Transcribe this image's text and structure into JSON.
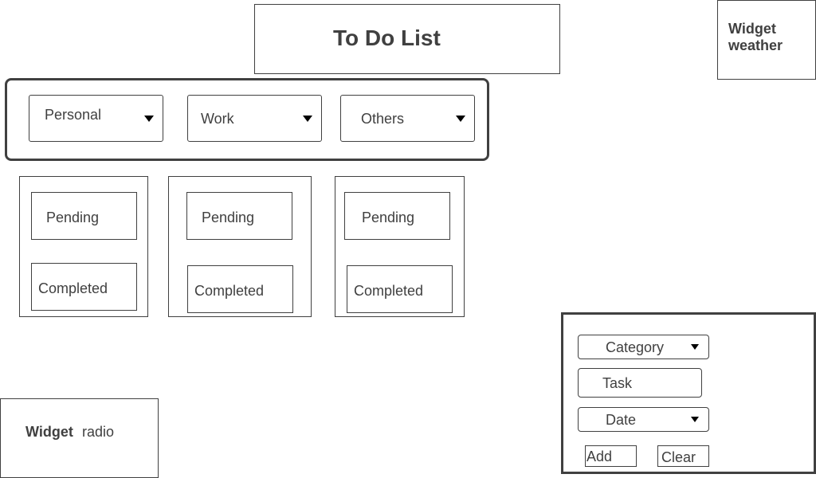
{
  "header": {
    "title": "To Do List"
  },
  "widgets": {
    "weather": {
      "bold_label": "Widget",
      "label": "weather"
    },
    "radio": {
      "bold_label": "Widget",
      "label": "radio"
    }
  },
  "category_tabs": [
    {
      "label": "Personal"
    },
    {
      "label": "Work"
    },
    {
      "label": "Others"
    }
  ],
  "columns": [
    {
      "pending_label": "Pending",
      "completed_label": "Completed"
    },
    {
      "pending_label": "Pending",
      "completed_label": "Completed"
    },
    {
      "pending_label": "Pending",
      "completed_label": "Completed"
    }
  ],
  "form": {
    "category_label": "Category",
    "task_label": "Task",
    "date_label": "Date",
    "add_label": "Add",
    "clear_label": "Clear"
  },
  "icons": {
    "dropdown": "caret-down-icon"
  }
}
